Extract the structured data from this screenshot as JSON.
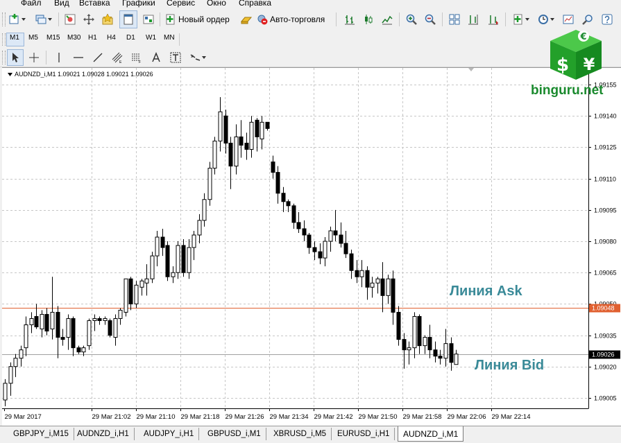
{
  "menu": [
    "Файл",
    "Вид",
    "Вставка",
    "Графики",
    "Сервис",
    "Окно",
    "Справка"
  ],
  "toolbar": {
    "new_order_label": "Новый ордер",
    "auto_trading_label": "Авто-торговля"
  },
  "timeframes": [
    "M1",
    "M5",
    "M15",
    "M30",
    "H1",
    "H4",
    "D1",
    "W1",
    "MN"
  ],
  "selected_timeframe": "M1",
  "chart": {
    "title": "AUDNZD_i,M1  1.09021 1.09028 1.09021 1.09026",
    "ask_price_label": "1.09048",
    "bid_price_label": "1.09026",
    "ask_color": "#e06030",
    "bid_color": "#a0a0a0"
  },
  "annotations": {
    "ask": "Линия Ask",
    "bid": "Линия Bid"
  },
  "watermark": {
    "site": "binguru.net",
    "symbols": [
      "€",
      "$",
      "¥"
    ]
  },
  "tabs": [
    "GBPJPY_i,M15",
    "AUDNZD_i,H1",
    "AUDJPY_i,H1",
    "GBPUSD_i,M1",
    "XBRUSD_i,M5",
    "EURUSD_i,H1",
    "AUDNZD_i,M1"
  ],
  "active_tab": "AUDNZD_i,M1",
  "chart_data": {
    "type": "candlestick",
    "symbol": "AUDNZD_i",
    "timeframe": "M1",
    "ohlc_header": {
      "open": 1.09021,
      "high": 1.09028,
      "low": 1.09021,
      "close": 1.09026
    },
    "y_ticks": [
      "1.09155",
      "1.09140",
      "1.09125",
      "1.09110",
      "1.09095",
      "1.09080",
      "1.09065",
      "1.09050",
      "1.09035",
      "1.09020",
      "1.09005"
    ],
    "x_ticks": [
      "29 Mar 2017",
      "29 Mar 21:02",
      "29 Mar 21:10",
      "29 Mar 21:18",
      "29 Mar 21:26",
      "29 Mar 21:34",
      "29 Mar 21:42",
      "29 Mar 21:50",
      "29 Mar 21:58",
      "29 Mar 22:06",
      "29 Mar 22:14"
    ],
    "ylim": [
      1.09,
      1.0916
    ],
    "ask": 1.09048,
    "bid": 1.09026,
    "grid": true,
    "candles": [
      [
        1.09004,
        1.09014,
        1.09001,
        1.09012
      ],
      [
        1.09012,
        1.09022,
        1.09006,
        1.0902
      ],
      [
        1.0902,
        1.09026,
        1.09015,
        1.09024
      ],
      [
        1.09024,
        1.0903,
        1.0902,
        1.09028
      ],
      [
        1.09029,
        1.09044,
        1.09025,
        1.0904
      ],
      [
        1.0904,
        1.09046,
        1.09036,
        1.09043
      ],
      [
        1.09044,
        1.0905,
        1.09038,
        1.09039
      ],
      [
        1.09038,
        1.09047,
        1.09034,
        1.09045
      ],
      [
        1.09045,
        1.09048,
        1.09035,
        1.09037
      ],
      [
        1.09038,
        1.09063,
        1.09033,
        1.09046
      ],
      [
        1.09046,
        1.09049,
        1.09024,
        1.09034
      ],
      [
        1.09034,
        1.09038,
        1.0903,
        1.09033
      ],
      [
        1.09034,
        1.09045,
        1.09028,
        1.09043
      ],
      [
        1.09043,
        1.09044,
        1.09025,
        1.09029
      ],
      [
        1.09029,
        1.0903,
        1.09026,
        1.09027
      ],
      [
        1.09027,
        1.0903,
        1.09025,
        1.09029
      ],
      [
        1.0903,
        1.09043,
        1.09028,
        1.09042
      ],
      [
        1.09042,
        1.09045,
        1.09037,
        1.09043
      ],
      [
        1.09043,
        1.09044,
        1.0904,
        1.09042
      ],
      [
        1.09042,
        1.09044,
        1.0904,
        1.09043
      ],
      [
        1.09042,
        1.09043,
        1.09034,
        1.09035
      ],
      [
        1.09034,
        1.09045,
        1.0903,
        1.09043
      ],
      [
        1.09043,
        1.09048,
        1.0904,
        1.09047
      ],
      [
        1.09046,
        1.0906,
        1.09044,
        1.09062
      ],
      [
        1.09062,
        1.09063,
        1.09047,
        1.0905
      ],
      [
        1.0905,
        1.09061,
        1.09048,
        1.09059
      ],
      [
        1.09058,
        1.09062,
        1.09054,
        1.09061
      ],
      [
        1.0906,
        1.09069,
        1.09054,
        1.09062
      ],
      [
        1.09062,
        1.09075,
        1.0906,
        1.09073
      ],
      [
        1.09073,
        1.09085,
        1.09068,
        1.09082
      ],
      [
        1.09082,
        1.09086,
        1.09073,
        1.09077
      ],
      [
        1.09078,
        1.0908,
        1.09061,
        1.09063
      ],
      [
        1.09063,
        1.09068,
        1.0906,
        1.09065
      ],
      [
        1.09065,
        1.0908,
        1.09062,
        1.09078
      ],
      [
        1.09078,
        1.09081,
        1.09063,
        1.09065
      ],
      [
        1.09065,
        1.09081,
        1.09062,
        1.09077
      ],
      [
        1.09077,
        1.09085,
        1.09071,
        1.09083
      ],
      [
        1.09083,
        1.09093,
        1.09079,
        1.0909
      ],
      [
        1.0909,
        1.09103,
        1.09087,
        1.091
      ],
      [
        1.091,
        1.09118,
        1.09097,
        1.09115
      ],
      [
        1.09115,
        1.0913,
        1.09112,
        1.09128
      ],
      [
        1.09128,
        1.09149,
        1.09123,
        1.09142
      ],
      [
        1.0914,
        1.09143,
        1.09122,
        1.09127
      ],
      [
        1.09127,
        1.0913,
        1.09105,
        1.09116
      ],
      [
        1.09116,
        1.09136,
        1.09112,
        1.0913
      ],
      [
        1.0913,
        1.09138,
        1.0912,
        1.09126
      ],
      [
        1.09127,
        1.09132,
        1.09119,
        1.09124
      ],
      [
        1.09124,
        1.0914,
        1.0912,
        1.09137
      ],
      [
        1.09138,
        1.09139,
        1.09123,
        1.0913
      ],
      [
        1.09129,
        1.0914,
        1.09124,
        1.09137
      ],
      [
        1.09137,
        1.09137,
        1.09133,
        1.09134
      ],
      [
        1.09118,
        1.09121,
        1.0911,
        1.09113
      ],
      [
        1.09113,
        1.09116,
        1.09098,
        1.09103
      ],
      [
        1.09103,
        1.09106,
        1.09094,
        1.09099
      ],
      [
        1.09099,
        1.091,
        1.09094,
        1.09097
      ],
      [
        1.09097,
        1.09098,
        1.09086,
        1.09089
      ],
      [
        1.09089,
        1.09094,
        1.09084,
        1.09086
      ],
      [
        1.09086,
        1.0909,
        1.0908,
        1.09083
      ],
      [
        1.09083,
        1.09084,
        1.09074,
        1.09077
      ],
      [
        1.09077,
        1.0908,
        1.09071,
        1.09075
      ],
      [
        1.09075,
        1.09079,
        1.09069,
        1.09072
      ],
      [
        1.09072,
        1.09082,
        1.09068,
        1.0908
      ],
      [
        1.0908,
        1.09087,
        1.09075,
        1.09085
      ],
      [
        1.09085,
        1.09095,
        1.0908,
        1.09083
      ],
      [
        1.09083,
        1.09089,
        1.09077,
        1.09079
      ],
      [
        1.09079,
        1.09085,
        1.09072,
        1.09074
      ],
      [
        1.09074,
        1.09076,
        1.09062,
        1.09066
      ],
      [
        1.09066,
        1.09071,
        1.0906,
        1.09063
      ],
      [
        1.09063,
        1.09071,
        1.09058,
        1.09066
      ],
      [
        1.09066,
        1.09068,
        1.09052,
        1.09058
      ],
      [
        1.09058,
        1.09063,
        1.09053,
        1.0906
      ],
      [
        1.0906,
        1.09063,
        1.09055,
        1.09062
      ],
      [
        1.09062,
        1.0907,
        1.09046,
        1.09054
      ],
      [
        1.09054,
        1.09064,
        1.0905,
        1.09062
      ],
      [
        1.09062,
        1.09066,
        1.0904,
        1.09046
      ],
      [
        1.09046,
        1.09049,
        1.0903,
        1.09033
      ],
      [
        1.09033,
        1.09036,
        1.09019,
        1.09028
      ],
      [
        1.09028,
        1.09032,
        1.09021,
        1.09029
      ],
      [
        1.09029,
        1.09046,
        1.09024,
        1.09044
      ],
      [
        1.09044,
        1.09045,
        1.09026,
        1.0903
      ],
      [
        1.0903,
        1.09035,
        1.09026,
        1.09034
      ],
      [
        1.09034,
        1.0904,
        1.09024,
        1.09028
      ],
      [
        1.09028,
        1.09032,
        1.09022,
        1.09025
      ],
      [
        1.09025,
        1.09028,
        1.09021,
        1.09024
      ],
      [
        1.09024,
        1.09038,
        1.0902,
        1.09031
      ],
      [
        1.09031,
        1.09034,
        1.09018,
        1.09022
      ],
      [
        1.09021,
        1.09028,
        1.09021,
        1.09026
      ]
    ]
  }
}
